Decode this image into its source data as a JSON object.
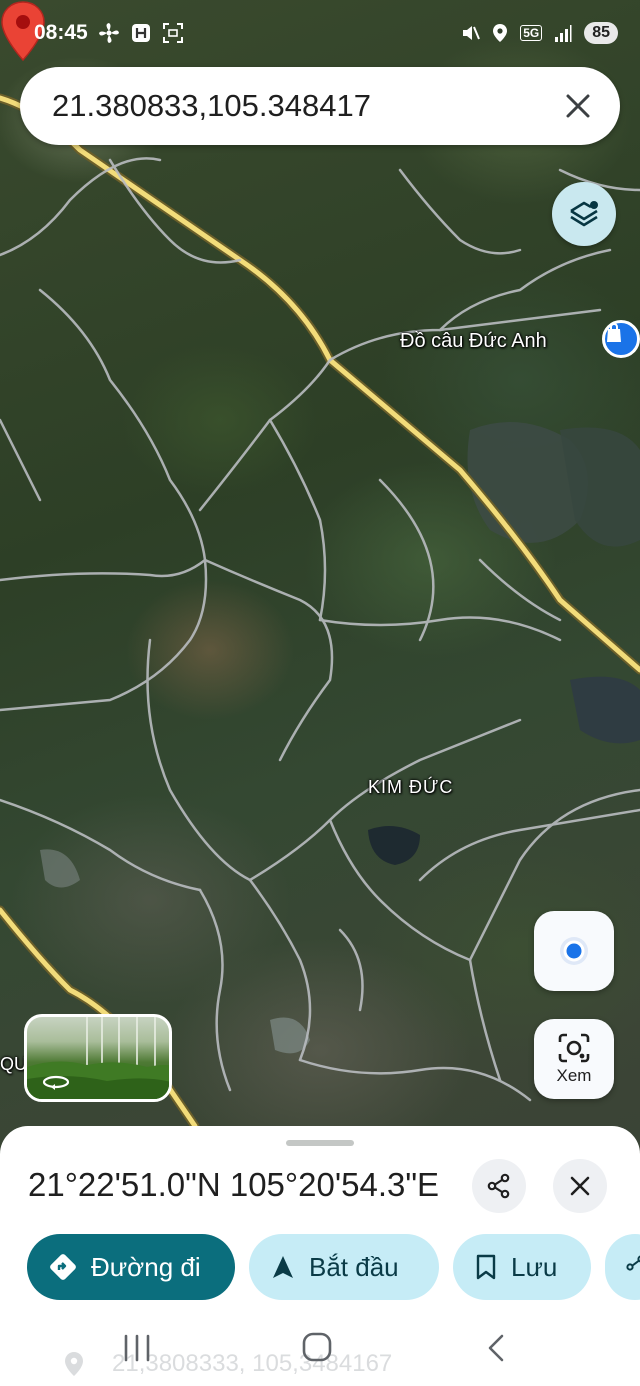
{
  "status_bar": {
    "time": "08:45",
    "network": "5G",
    "battery": "85"
  },
  "search": {
    "query": "21.380833,105.348417"
  },
  "map": {
    "labels": {
      "shop": "Đồ câu Đức Anh",
      "district": "KIM ĐỨC",
      "edge_partial": "QU"
    },
    "icons": [
      "layers-icon",
      "shopping-bag-icon",
      "map-pin-icon",
      "my-location-icon",
      "lens-icon",
      "rotate-360-icon"
    ]
  },
  "controls": {
    "lens_label": "Xem"
  },
  "place": {
    "title": "21°22'51.0\"N 105°20'54.3\"E",
    "subtitle": "21,3808333, 105,3484167"
  },
  "actions": {
    "directions": "Đường đi",
    "start": "Bắt đầu",
    "save": "Lưu"
  },
  "colors": {
    "primary_chip": "#0b6e7d",
    "secondary_chip": "#c6ecf6",
    "pin": "#ea4335",
    "location_dot": "#1a73e8"
  }
}
